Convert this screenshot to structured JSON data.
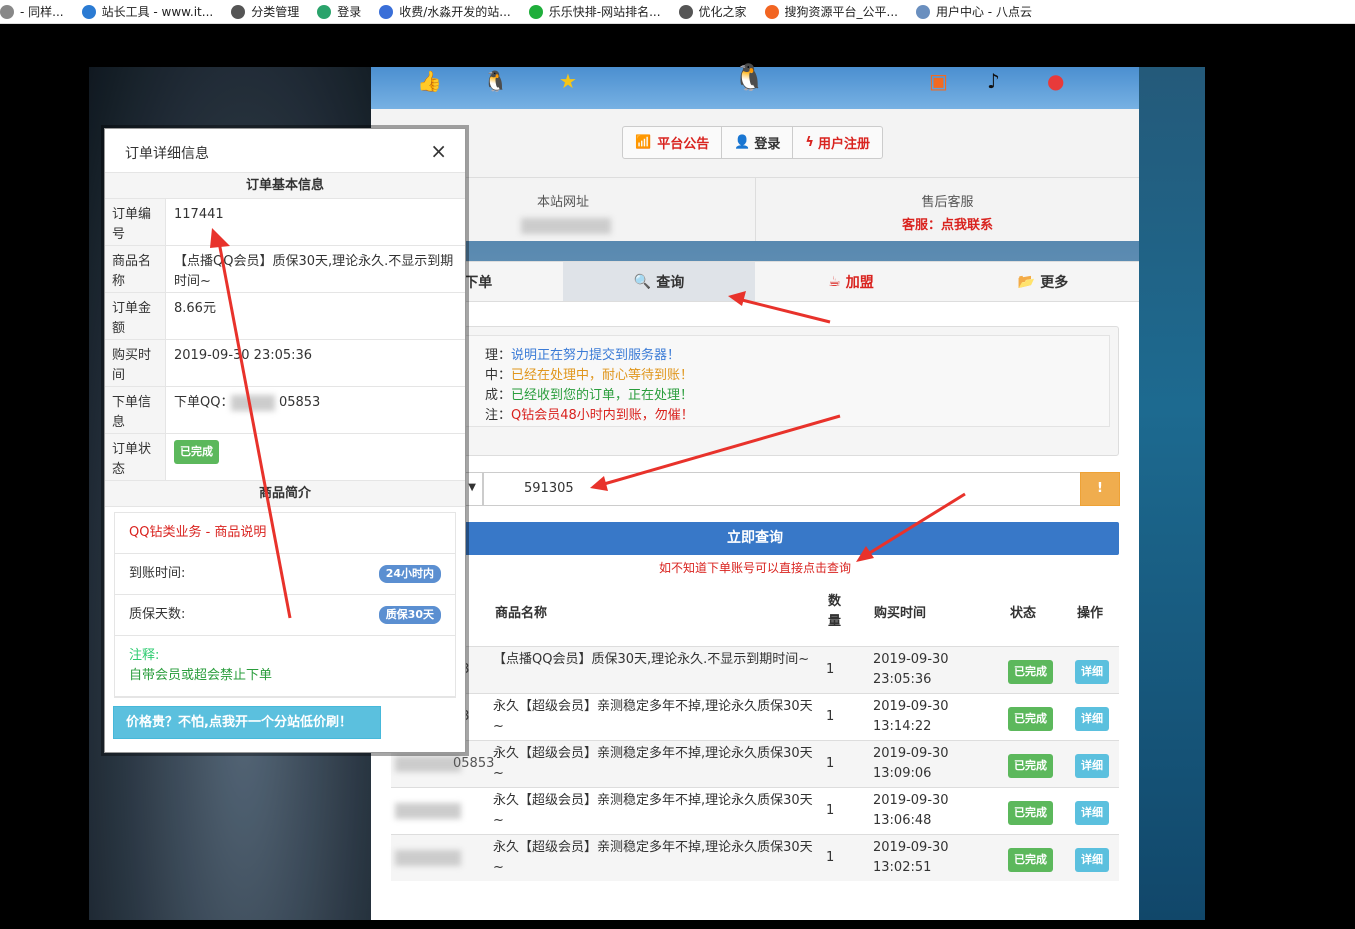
{
  "bookmarks": [
    {
      "label": "- 同样...",
      "color": "#888888"
    },
    {
      "label": "站长工具 - www.it...",
      "color": "#2b7bd3"
    },
    {
      "label": "分类管理",
      "color": "#555555"
    },
    {
      "label": "登录",
      "color": "#2aa36b"
    },
    {
      "label": "收费/水淼开发的站...",
      "color": "#3a6fd8"
    },
    {
      "label": "乐乐快排-网站排名...",
      "color": "#1fae3b"
    },
    {
      "label": "优化之家",
      "color": "#555555"
    },
    {
      "label": "搜狗资源平台_公平...",
      "color": "#f26522"
    },
    {
      "label": "用户中心 - 八点云",
      "color": "#6a8fbf"
    }
  ],
  "nav": {
    "announce": "平台公告",
    "login": "登录",
    "register": "用户注册"
  },
  "info": {
    "site_label": "本站网址",
    "support_label": "售后客服",
    "support_value": "客服：点我联系"
  },
  "tabs": {
    "order": "下单",
    "query": "查询",
    "join": "加盟",
    "more": "更多"
  },
  "notice_lines": [
    {
      "prefix": "理：",
      "text": "说明正在努力提交到服务器！",
      "color": "#3b7bd6"
    },
    {
      "prefix": "中：",
      "text": "已经在处理中，耐心等待到账！",
      "color": "#e0961c"
    },
    {
      "prefix": "成：",
      "text": "已经收到您的订单，正在处理！",
      "color": "#2a9d3c"
    },
    {
      "prefix": "注：",
      "text": "Q钻会员48小时内到账，勿催！",
      "color": "#d9231f"
    }
  ],
  "search": {
    "value": "591305",
    "warn_icon": "!"
  },
  "query_button": "立即查询",
  "hint": "如不知道下单账号可以直接点击查询",
  "table": {
    "headers": {
      "name": "商品名称",
      "qty": "数量",
      "time": "购买时间",
      "status": "状态",
      "action": "操作"
    },
    "rows": [
      {
        "id": "53",
        "name": "【点播QQ会员】质保30天,理论永久.不显示到期时间~",
        "qty": "1",
        "date": "2019-09-30",
        "time": "23:05:36",
        "status": "已完成",
        "action": "详细"
      },
      {
        "id": "53",
        "name": "永久【超级会员】亲测稳定多年不掉,理论永久质保30天~",
        "qty": "1",
        "date": "2019-09-30",
        "time": "13:14:22",
        "status": "已完成",
        "action": "详细"
      },
      {
        "id": "05853",
        "name": "永久【超级会员】亲测稳定多年不掉,理论永久质保30天~",
        "qty": "1",
        "date": "2019-09-30",
        "time": "13:09:06",
        "status": "已完成",
        "action": "详细"
      },
      {
        "id": "",
        "name": "永久【超级会员】亲测稳定多年不掉,理论永久质保30天~",
        "qty": "1",
        "date": "2019-09-30",
        "time": "13:06:48",
        "status": "已完成",
        "action": "详细"
      },
      {
        "id": "",
        "name": "永久【超级会员】亲测稳定多年不掉,理论永久质保30天~",
        "qty": "1",
        "date": "2019-09-30",
        "time": "13:02:51",
        "status": "已完成",
        "action": "详细"
      }
    ]
  },
  "modal": {
    "title": "订单详细信息",
    "close": "×",
    "section_basic": "订单基本信息",
    "rows": [
      {
        "key": "订单编号",
        "value": "117441"
      },
      {
        "key": "商品名称",
        "value": "【点播QQ会员】质保30天,理论永久.不显示到期时间~"
      },
      {
        "key": "订单金额",
        "value": "8.66元"
      },
      {
        "key": "购买时间",
        "value": "2019-09-30 23:05:36"
      },
      {
        "key": "下单信息",
        "value": "下单QQ：　　　　05853"
      },
      {
        "key": "订单状态",
        "value": "已完成"
      }
    ],
    "section_intro": "商品简介",
    "product_title": "QQ钻类业务 - 商品说明",
    "arrival_label": "到账时间:",
    "arrival_value": "24小时内",
    "warranty_label": "质保天数:",
    "warranty_value": "质保30天",
    "note_label": "注释:",
    "note_text": "自带会员或超会禁止下单",
    "cheap_button": "价格贵？不怕,点我开一个分站低价刷！"
  },
  "colors": {
    "accent_red": "#d9231f",
    "primary_blue": "#3878c8",
    "success_green": "#5cb85c",
    "info_blue": "#5bc0de",
    "warning_orange": "#f0ad4e",
    "arrow_red": "#e8322b"
  }
}
